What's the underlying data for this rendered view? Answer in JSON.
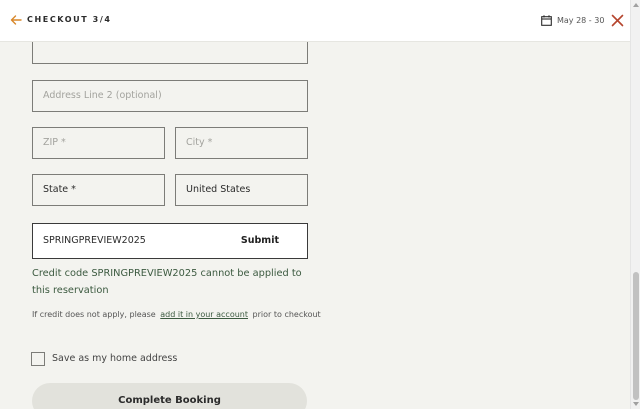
{
  "header": {
    "step_label": "CHECKOUT 3/4",
    "dates": "May 28 - 30"
  },
  "form": {
    "address_line2": {
      "placeholder": "Address Line 2 (optional)",
      "value": ""
    },
    "zip": {
      "placeholder": "ZIP *",
      "value": ""
    },
    "city": {
      "placeholder": "City *",
      "value": ""
    },
    "state": {
      "value": "State *"
    },
    "country": {
      "value": "United States"
    },
    "credit_code": {
      "value": "SPRINGPREVIEW2025"
    },
    "submit_label": "Submit",
    "error_message": "Credit code SPRINGPREVIEW2025 cannot be applied to this reservation",
    "note_prefix": "If credit does not apply, please",
    "note_link": "add it in your account",
    "note_suffix": "prior to checkout",
    "save_home_label": "Save as my home address",
    "save_home_checked": false,
    "complete_label": "Complete Booking"
  },
  "colors": {
    "accent_orange": "#d8872a",
    "close_red": "#b5452e",
    "error_green": "#3c5a40",
    "background": "#f3f3ef"
  },
  "icons": {
    "back": "arrow-left",
    "calendar": "calendar",
    "close": "x"
  }
}
